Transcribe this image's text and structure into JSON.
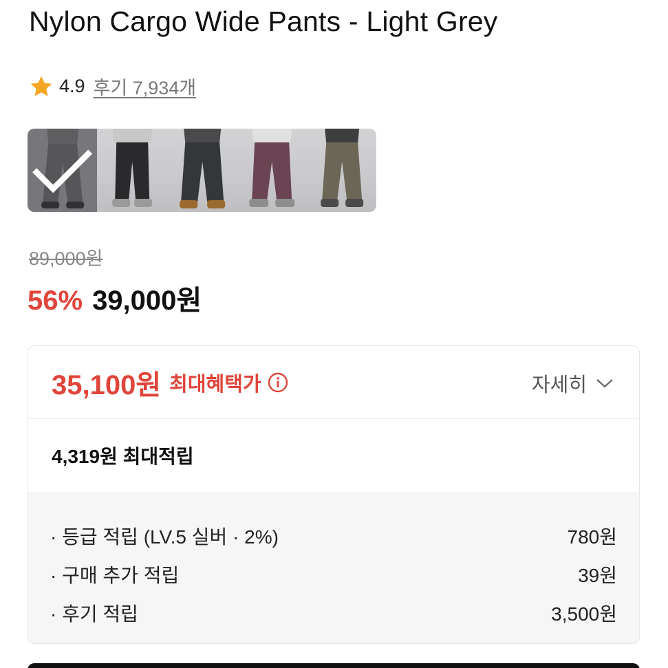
{
  "product": {
    "title": "Nylon Cargo Wide Pants - Light Grey",
    "rating": "4.9",
    "reviews_label": "후기 7,934개"
  },
  "thumbnails": [
    {
      "color": "light-grey",
      "selected": true
    },
    {
      "color": "black",
      "selected": false
    },
    {
      "color": "charcoal",
      "selected": false
    },
    {
      "color": "plum",
      "selected": false
    },
    {
      "color": "khaki",
      "selected": false
    }
  ],
  "price": {
    "original": "89,000원",
    "discount": "56%",
    "sale": "39,000원"
  },
  "benefit": {
    "max_price": "35,100원",
    "max_label": "최대혜택가",
    "detail_label": "자세히",
    "points_total": "4,319원 최대적립",
    "points": [
      {
        "label": "· 등급 적립 (LV.5 실버 · 2%)",
        "value": "780원"
      },
      {
        "label": "· 구매 추가 적립",
        "value": "39원"
      },
      {
        "label": "· 후기 적립",
        "value": "3,500원"
      }
    ]
  },
  "colors": {
    "accent_red": "#e0443a",
    "star": "#f5a623"
  }
}
